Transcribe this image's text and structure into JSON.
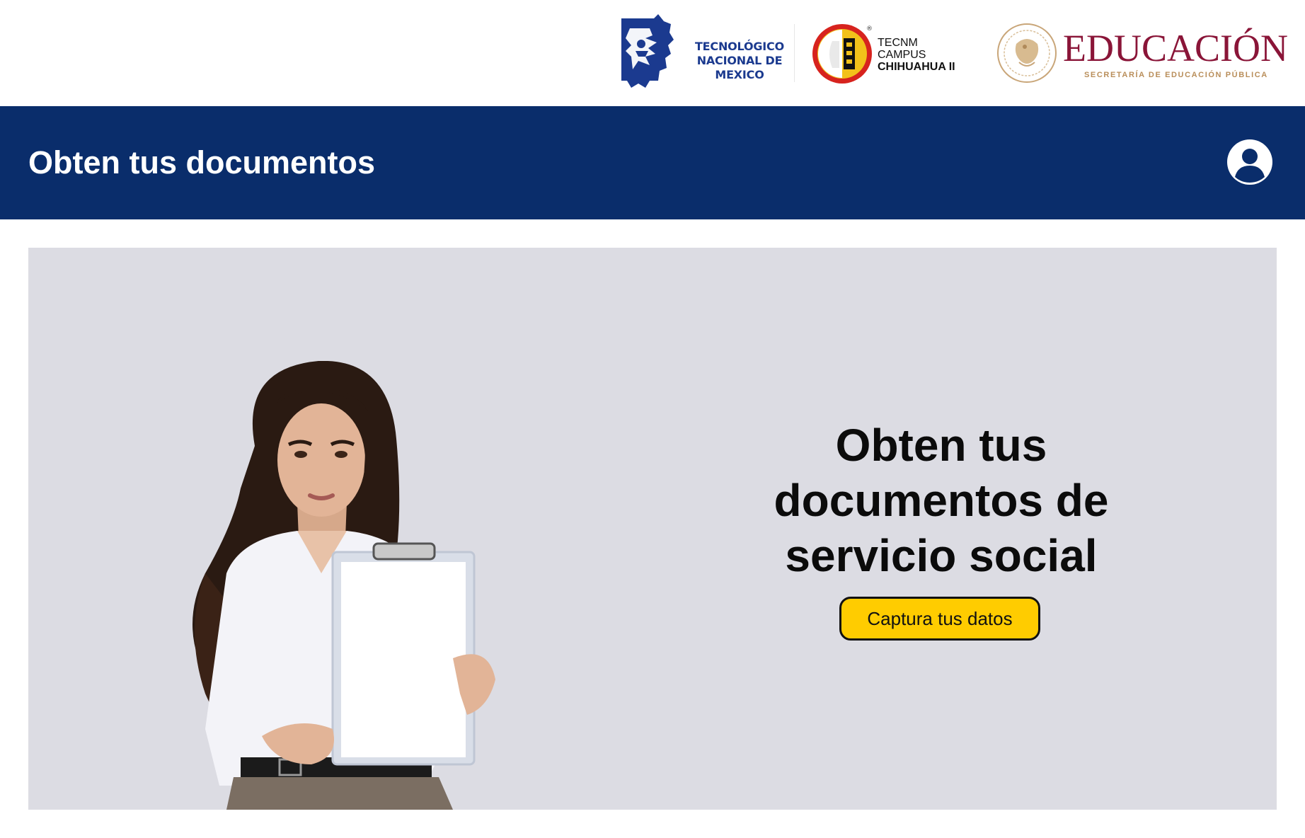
{
  "header": {
    "logos": {
      "tecnm": {
        "line1": "TECNOLÓGICO",
        "line2": "NACIONAL DE MEXICO"
      },
      "campus": {
        "line1": "TECNM",
        "line2": "CAMPUS",
        "line3": "CHIHUAHUA II",
        "registered": "®"
      },
      "sep": {
        "word": "EDUCACIÓN",
        "sub": "SECRETARÍA DE EDUCACIÓN PÚBLICA"
      }
    }
  },
  "navbar": {
    "title": "Obten tus documentos",
    "user_icon": "account-circle-icon",
    "background": "#0a2d6b"
  },
  "hero": {
    "headline_line1": "Obten tus",
    "headline_line2": "documentos de",
    "headline_line3": "servicio social",
    "cta_label": "Captura tus datos",
    "cta_color": "#ffcc00",
    "background": "#dcdce3"
  },
  "colors": {
    "sep_burgundy": "#8a1538",
    "sep_gold": "#b98e5a",
    "tecnm_blue": "#1b3a8f"
  }
}
